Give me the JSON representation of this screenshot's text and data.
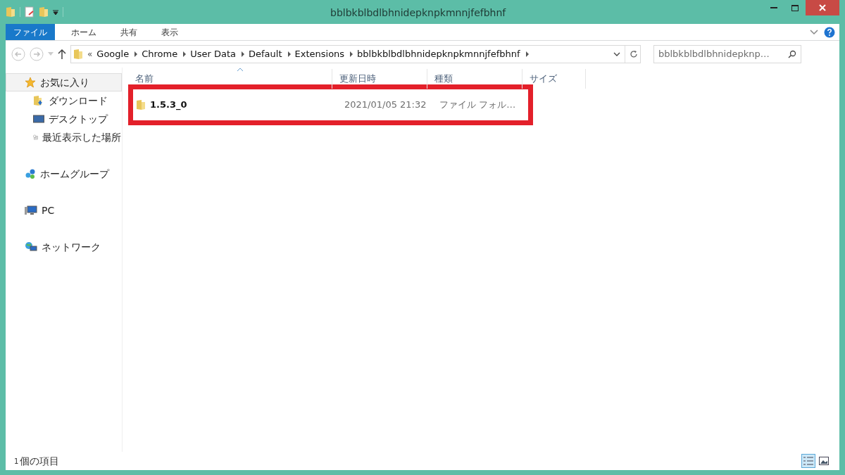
{
  "window": {
    "title": "bblbkblbdlbhnidepknpkmnnjfefbhnf"
  },
  "ribbon_tabs": [
    {
      "label": "ファイル",
      "selected": true
    },
    {
      "label": "ホーム",
      "selected": false
    },
    {
      "label": "共有",
      "selected": false
    },
    {
      "label": "表示",
      "selected": false
    }
  ],
  "address_bar": {
    "overflow": "«",
    "segments": [
      "Google",
      "Chrome",
      "User Data",
      "Default",
      "Extensions",
      "bblbkblbdlbhnidepknpkmnnjfefbhnf"
    ]
  },
  "search": {
    "value": "bblbkblbdlbhnidepknp…"
  },
  "sidebar": {
    "groups": [
      {
        "label": "お気に入り",
        "kind": "favorites",
        "selected": true,
        "children": [
          {
            "label": "ダウンロード",
            "kind": "downloads",
            "selected": false
          },
          {
            "label": "デスクトップ",
            "kind": "desktop",
            "selected": false
          },
          {
            "label": "最近表示した場所",
            "kind": "recent",
            "selected": false
          }
        ]
      },
      {
        "label": "ホームグループ",
        "kind": "homegroup",
        "selected": false
      },
      {
        "label": "PC",
        "kind": "pc",
        "selected": false
      },
      {
        "label": "ネットワーク",
        "kind": "network",
        "selected": false
      }
    ]
  },
  "table": {
    "columns": [
      "名前",
      "更新日時",
      "種類",
      "サイズ"
    ],
    "rows": [
      {
        "name": "1.5.3_0",
        "modified": "2021/01/05 21:32",
        "type": "ファイル フォル…",
        "highlighted": true
      }
    ]
  },
  "status_bar": {
    "count": "1",
    "text": "個の項目",
    "views": [
      {
        "kind": "details",
        "selected": true
      },
      {
        "kind": "large",
        "selected": false
      }
    ]
  }
}
